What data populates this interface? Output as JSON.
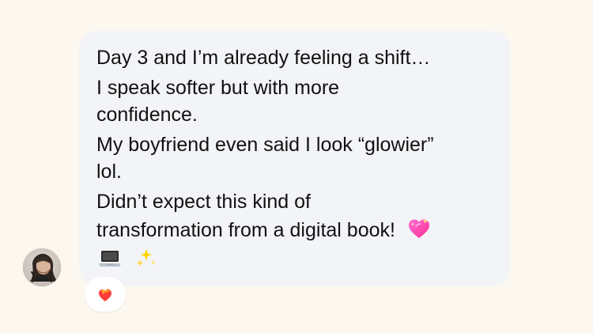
{
  "message": {
    "lines": [
      "Day 3 and I’m already feeling a shift…",
      "I speak softer but with more",
      "confidence.",
      "My boyfriend even said I look “glowier”",
      "lol.",
      "Didn’t expect this kind of",
      "transformation from a digital book!"
    ],
    "inline_emoji": "sparkling-heart",
    "trailing_emojis": [
      "laptop",
      "sparkles"
    ]
  },
  "reaction": {
    "emoji": "heart-on-fire"
  },
  "icons": {
    "avatar": "avatar",
    "sparkling-heart": "sparkling-heart-icon",
    "laptop": "laptop-icon",
    "sparkles": "sparkles-icon",
    "reaction": "heart-on-fire-icon"
  }
}
